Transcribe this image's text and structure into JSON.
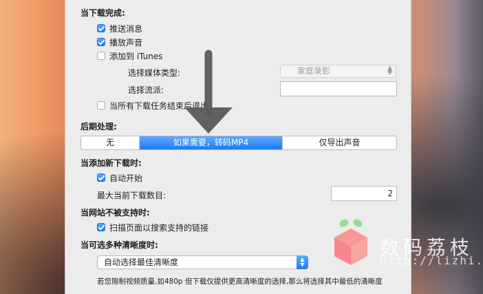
{
  "on_download_complete": {
    "heading": "当下载完成:",
    "push_notification": {
      "label": "推送消息",
      "checked": true
    },
    "play_sound": {
      "label": "播放声音",
      "checked": true
    },
    "add_to_itunes": {
      "label": "添加到 iTunes",
      "checked": false
    },
    "media_type": {
      "label": "选择媒体类型:",
      "value": "家庭录影"
    },
    "genre": {
      "label": "选择流派:",
      "value": ""
    },
    "quit_when_done": {
      "label": "当所有下载任务结束后退出",
      "checked": false
    }
  },
  "post_processing": {
    "heading": "后期处理:",
    "options": [
      "无",
      "如果需要，转码MP4",
      "仅导出声音"
    ],
    "selected": "如果需要，转码MP4"
  },
  "on_new_download": {
    "heading": "当添加新下载时:",
    "auto_start": {
      "label": "自动开始",
      "checked": true
    },
    "max_downloads": {
      "label": "最大当前下载数目:",
      "value": "2"
    }
  },
  "unsupported_site": {
    "heading": "当网站不被支持时:",
    "scan_links": {
      "label": "扫描页面以搜索支持的链接",
      "checked": true
    }
  },
  "multiple_qualities": {
    "heading": "当可选多种清晰度时:",
    "selected": "自动选择最佳清晰度",
    "note": "若您限制视频质量,如480p 但下载仅提供更高清晰度的选择,那么将选择其中最低的清晰度"
  },
  "watermark": {
    "name": "数码荔枝",
    "url": "http://lizhi.io"
  },
  "colors": {
    "accent": "#1e7cf2",
    "panel": "#ececec",
    "arrow": "#5a5a5a"
  }
}
